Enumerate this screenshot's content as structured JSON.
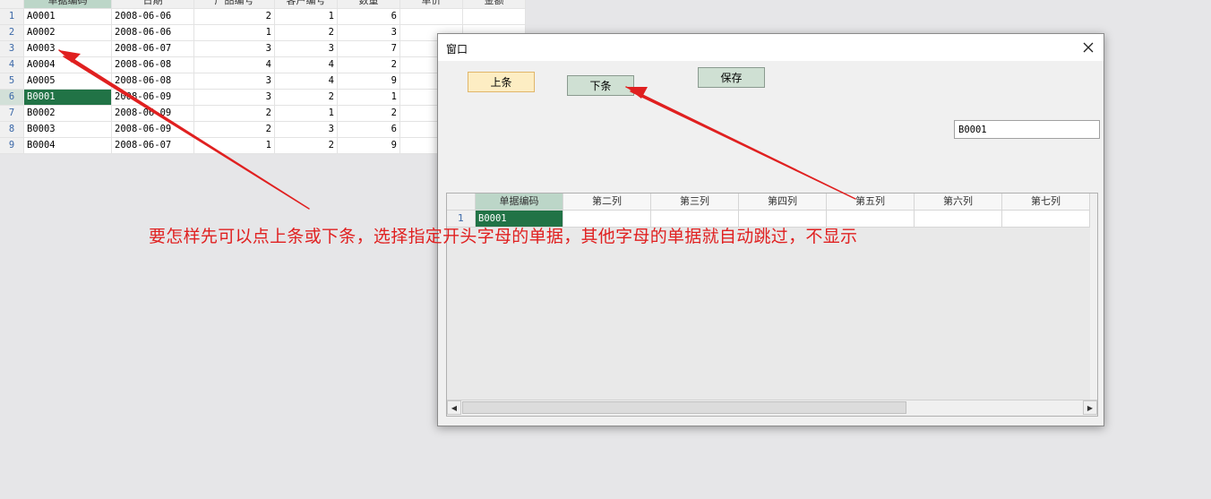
{
  "sheet": {
    "columns": [
      "单据编码",
      "日期",
      "产品编号",
      "客户编号",
      "数量",
      "单价",
      "金额"
    ],
    "rows": [
      {
        "n": "1",
        "code": "A0001",
        "date": "2008-06-06",
        "prod": "2",
        "cust": "1",
        "qty": "6"
      },
      {
        "n": "2",
        "code": "A0002",
        "date": "2008-06-06",
        "prod": "1",
        "cust": "2",
        "qty": "3"
      },
      {
        "n": "3",
        "code": "A0003",
        "date": "2008-06-07",
        "prod": "3",
        "cust": "3",
        "qty": "7"
      },
      {
        "n": "4",
        "code": "A0004",
        "date": "2008-06-08",
        "prod": "4",
        "cust": "4",
        "qty": "2"
      },
      {
        "n": "5",
        "code": "A0005",
        "date": "2008-06-08",
        "prod": "3",
        "cust": "4",
        "qty": "9"
      },
      {
        "n": "6",
        "code": "B0001",
        "date": "2008-06-09",
        "prod": "3",
        "cust": "2",
        "qty": "1"
      },
      {
        "n": "7",
        "code": "B0002",
        "date": "2008-06-09",
        "prod": "2",
        "cust": "1",
        "qty": "2"
      },
      {
        "n": "8",
        "code": "B0003",
        "date": "2008-06-09",
        "prod": "2",
        "cust": "3",
        "qty": "6"
      },
      {
        "n": "9",
        "code": "B0004",
        "date": "2008-06-07",
        "prod": "1",
        "cust": "2",
        "qty": "9"
      }
    ]
  },
  "dialog": {
    "title": "窗口",
    "prev_label": "上条",
    "next_label": "下条",
    "save_label": "保存",
    "code_value": "B0001",
    "grid": {
      "columns": [
        "单据编码",
        "第二列",
        "第三列",
        "第四列",
        "第五列",
        "第六列",
        "第七列"
      ],
      "rows": [
        {
          "n": "1",
          "code": "B0001"
        }
      ]
    }
  },
  "annotation": "要怎样先可以点上条或下条，选择指定开头字母的单据，其他字母的单据就自动跳过，不显示",
  "colors": {
    "selected_cell": "#217346",
    "annotation": "#e02020",
    "prev_button": "#fdedc3",
    "button": "#cfe0d3"
  },
  "icons": {
    "close": "close-icon",
    "scroll_left": "arrow-left-icon",
    "scroll_right": "arrow-right-icon"
  }
}
